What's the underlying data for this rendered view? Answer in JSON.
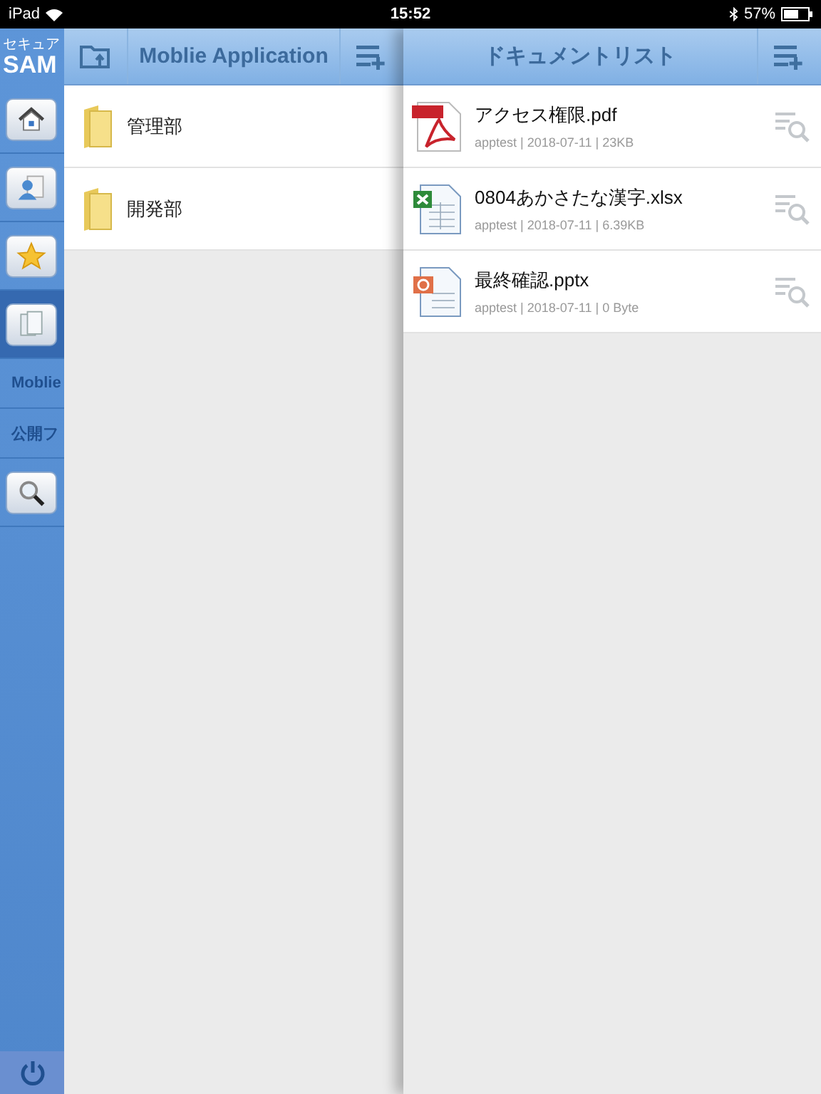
{
  "status_bar": {
    "device": "iPad",
    "time": "15:52",
    "battery": "57%"
  },
  "sidebar": {
    "logo_top": "セキュア",
    "logo_bottom": "SAM",
    "items": [
      {
        "kind": "home",
        "selected": false
      },
      {
        "kind": "contacts",
        "selected": false
      },
      {
        "kind": "star",
        "selected": false
      },
      {
        "kind": "documents",
        "selected": true
      },
      {
        "kind": "text",
        "label": "Moblie",
        "selected": false
      },
      {
        "kind": "text",
        "label": "公開フ",
        "selected": false
      },
      {
        "kind": "search",
        "selected": false
      }
    ]
  },
  "folder_panel": {
    "title": "Moblie Application",
    "folders": [
      {
        "name": "管理部"
      },
      {
        "name": "開発部"
      }
    ]
  },
  "document_panel": {
    "title": "ドキュメントリスト",
    "documents": [
      {
        "kind": "pdf",
        "name": "アクセス権限.pdf",
        "meta": "apptest | 2018-07-11 | 23KB"
      },
      {
        "kind": "spreadsheet",
        "name": "0804あかさたな漢字.xlsx",
        "meta": "apptest | 2018-07-11 | 6.39KB"
      },
      {
        "kind": "presentation",
        "name": "最終確認.pptx",
        "meta": "apptest | 2018-07-11 | 0 Byte"
      }
    ]
  }
}
